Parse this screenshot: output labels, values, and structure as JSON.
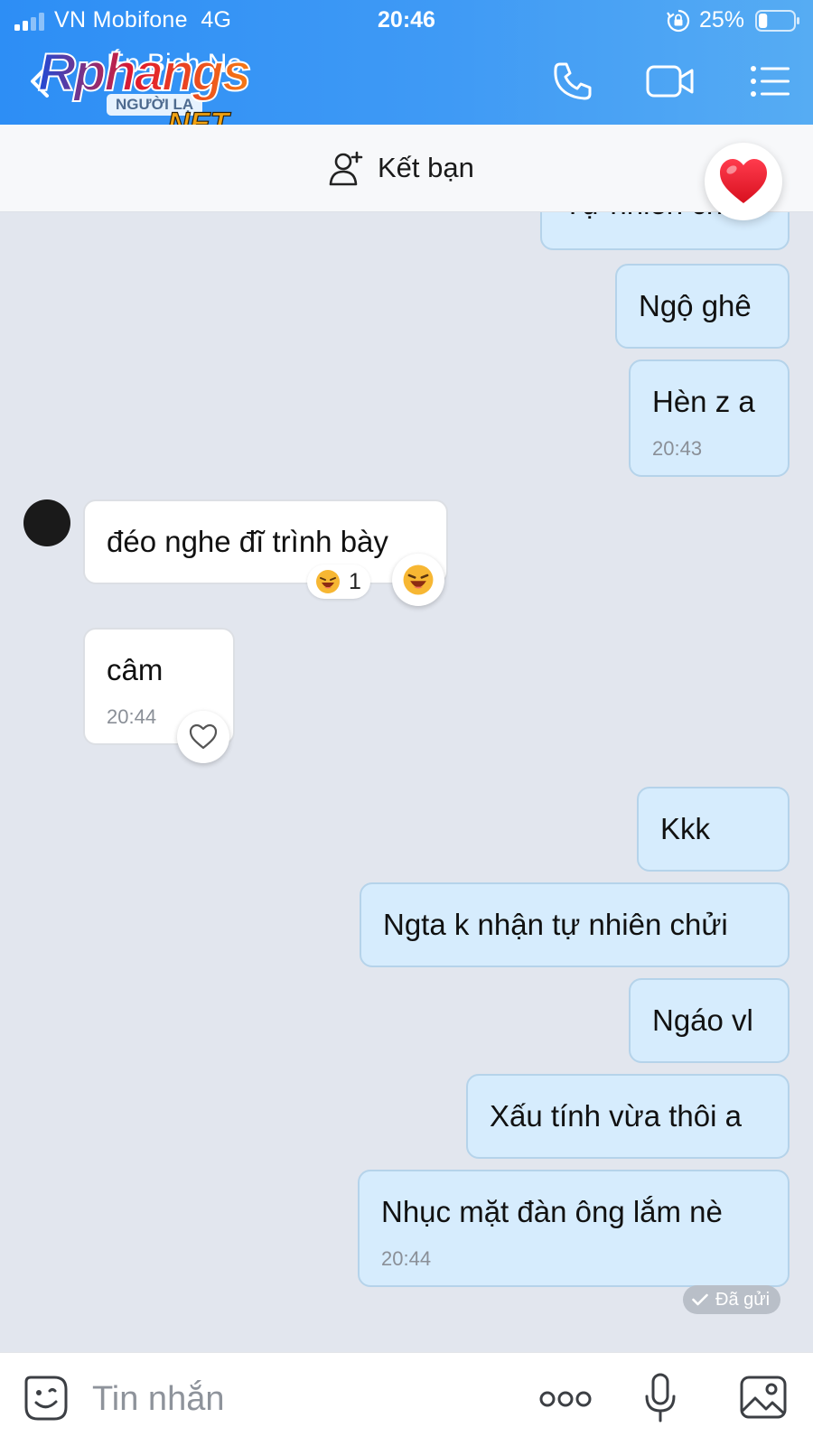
{
  "status_bar": {
    "carrier": "VN Mobifone",
    "network": "4G",
    "time": "20:46",
    "battery": "25%",
    "battery_level": 0.25
  },
  "header": {
    "contact_name": "Ép Bịch Nọ",
    "badge": "NGƯỜI LẠ"
  },
  "watermark": {
    "line1": "Rphangs",
    "line2": ".NET"
  },
  "friend_bar": {
    "label": "Kết bạn"
  },
  "messages": [
    {
      "text": "Tự nhiên chửi"
    },
    {
      "text": "Ngộ ghê"
    },
    {
      "text": "Hèn z a",
      "time": "20:43"
    },
    {
      "text": "đéo nghe đĩ trình bày",
      "reaction_count": "1"
    },
    {
      "text": "câm",
      "time": "20:44"
    },
    {
      "text": "Kkk"
    },
    {
      "text": "Ngta k nhận tự nhiên chửi"
    },
    {
      "text": "Ngáo vl"
    },
    {
      "text": "Xấu tính vừa thôi a"
    },
    {
      "text": "Nhục mặt đàn ông lắm nè",
      "time": "20:44"
    }
  ],
  "sent_status": "Đã gửi",
  "input": {
    "placeholder": "Tin nhắn"
  },
  "colors": {
    "header": "#3f9af5",
    "sent_bubble": "#d6ecfd",
    "recv_bubble": "#ffffff",
    "chat_background": "#e2e6ee"
  }
}
